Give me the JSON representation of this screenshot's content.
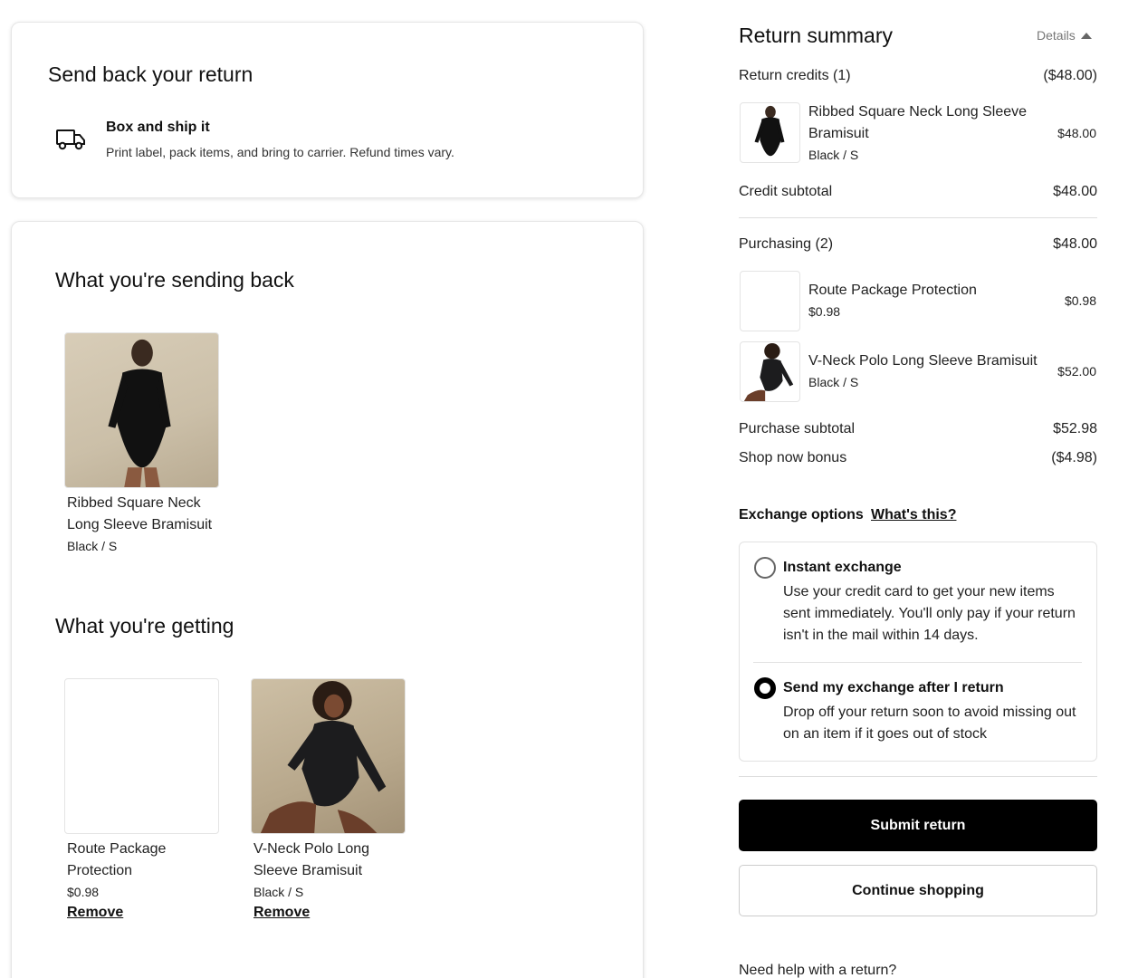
{
  "ship_card": {
    "title": "Send back your return",
    "method_label": "Box and ship it",
    "method_desc": "Print label, pack items, and bring to carrier. Refund times vary.",
    "icon": "truck-icon"
  },
  "sending_back": {
    "title": "What you're sending back",
    "items": [
      {
        "name_line1": "Ribbed Square Neck",
        "name_line2": "Long Sleeve Bramisuit",
        "variant": "Black / S"
      }
    ]
  },
  "getting": {
    "title": "What you're getting",
    "items": [
      {
        "name_line1": "Route Package",
        "name_line2": "Protection",
        "price": "$0.98",
        "remove": "Remove"
      },
      {
        "name_line1": "V-Neck Polo Long",
        "name_line2": "Sleeve Bramisuit",
        "variant": "Black / S",
        "remove": "Remove"
      }
    ]
  },
  "summary": {
    "title": "Return summary",
    "details_toggle": "Details",
    "return_credits_label": "Return credits (1)",
    "return_credits_amount": "($48.00)",
    "credit_items": [
      {
        "name_line1": "Ribbed Square Neck Long Sleeve",
        "name_line2": "Bramisuit",
        "variant": "Black / S",
        "amount": "$48.00"
      }
    ],
    "credit_subtotal_label": "Credit subtotal",
    "credit_subtotal_amount": "$48.00",
    "purchasing_label": "Purchasing (2)",
    "purchasing_amount": "$48.00",
    "purchase_items": [
      {
        "name": "Route Package Protection",
        "sub": "$0.98",
        "amount": "$0.98"
      },
      {
        "name": "V-Neck Polo Long Sleeve Bramisuit",
        "sub": "Black / S",
        "amount": "$52.00"
      }
    ],
    "purchase_subtotal_label": "Purchase subtotal",
    "purchase_subtotal_amount": "$52.98",
    "bonus_label": "Shop now bonus",
    "bonus_amount": "($4.98)"
  },
  "exchange": {
    "label": "Exchange options",
    "link": "What's this?",
    "options": [
      {
        "title": "Instant exchange",
        "desc": "Use your credit card to get your new items sent immediately. You'll only pay if your return isn't in the mail within 14 days.",
        "selected": false
      },
      {
        "title": "Send my exchange after I return",
        "desc": "Drop off your return soon to avoid missing out on an item if it goes out of stock",
        "selected": true
      }
    ]
  },
  "actions": {
    "submit": "Submit return",
    "continue": "Continue shopping"
  },
  "help_text": "Need help with a return?"
}
